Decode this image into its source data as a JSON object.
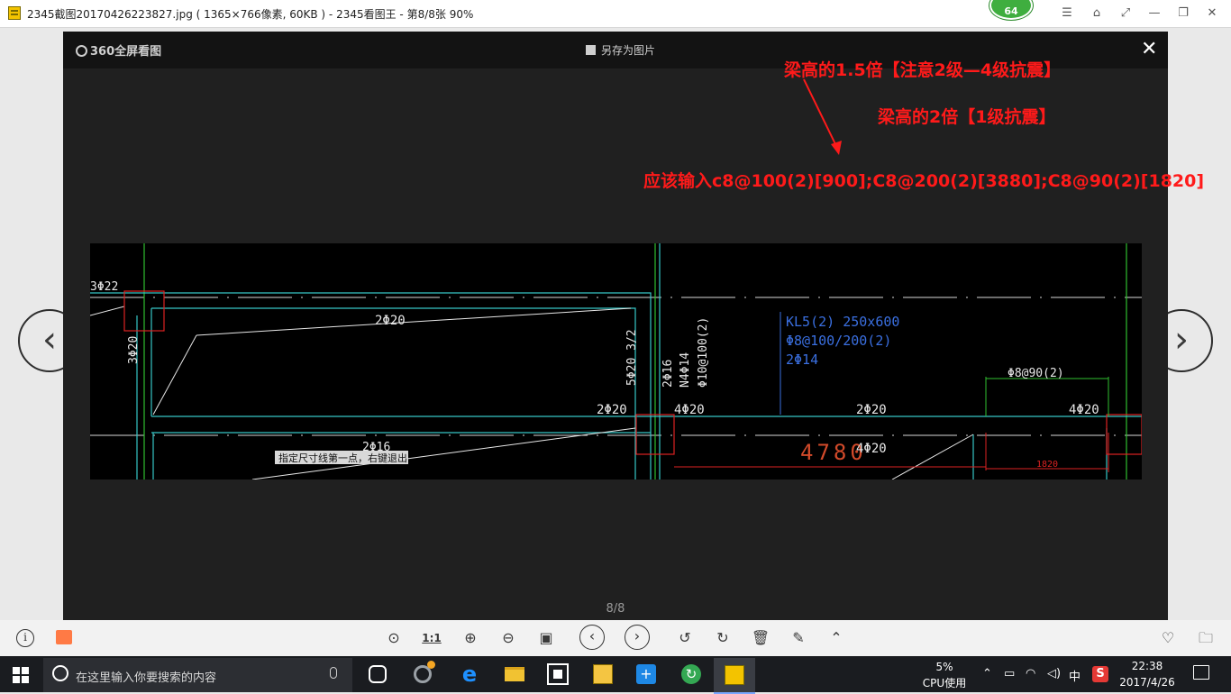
{
  "window": {
    "title": "2345截图20170426223827.jpg ( 1365×766像素, 60KB ) - 2345看图王 - 第8/8张 90%",
    "badge": "64",
    "buttons": [
      "☰",
      "⌂",
      "⤢",
      "—",
      "❐",
      "✕"
    ]
  },
  "viewer": {
    "brand": "360全屏看图",
    "save_as": "另存为图片",
    "close": "✕",
    "prev": "‹",
    "next": "›",
    "counter": "8/8"
  },
  "annotations": {
    "line1": "梁高的1.5倍【注意2级—4级抗震】",
    "line2": "梁高的2倍【1级抗震】",
    "line3": "应该输入c8@100(2)[900];C8@200(2)[3880];C8@90(2)[1820]",
    "color": "#ff1a1a"
  },
  "cad": {
    "label_3phi22": "3Φ22",
    "label_3phi20": "3Φ20",
    "label_2phi20_top": "2Φ20",
    "label_5phi20": "5Φ20 3/2",
    "label_2phi16_v": "2Φ16",
    "label_n4phi14": "N4Φ14",
    "label_phi10": "Φ10@100(2)",
    "beam_name": "KL5(2) 250x600",
    "beam_stirrup": "Φ8@100/200(2)",
    "beam_waist": "2Φ14",
    "label_phi8_90": "Φ8@90(2)",
    "label_2phi20_a": "2Φ20",
    "label_4phi20_a": "4Φ20",
    "label_2phi20_b": "2Φ20",
    "label_4phi20_b": "4Φ20",
    "label_2phi16_bottom": "2Φ16",
    "dimension_4780": "4780",
    "label_4phi20_c": "4Φ20",
    "dimension_1820": "1820",
    "prompt": "指定尺寸线第一点，右键退出"
  },
  "toolbar": {
    "info": "i",
    "actual_size": "1:1"
  },
  "taskbar": {
    "search_placeholder": "在这里输入你要搜索的内容",
    "cpu_percent": "5%",
    "cpu_label": "CPU使用",
    "ime": "中",
    "time": "22:38",
    "date": "2017/4/26"
  }
}
